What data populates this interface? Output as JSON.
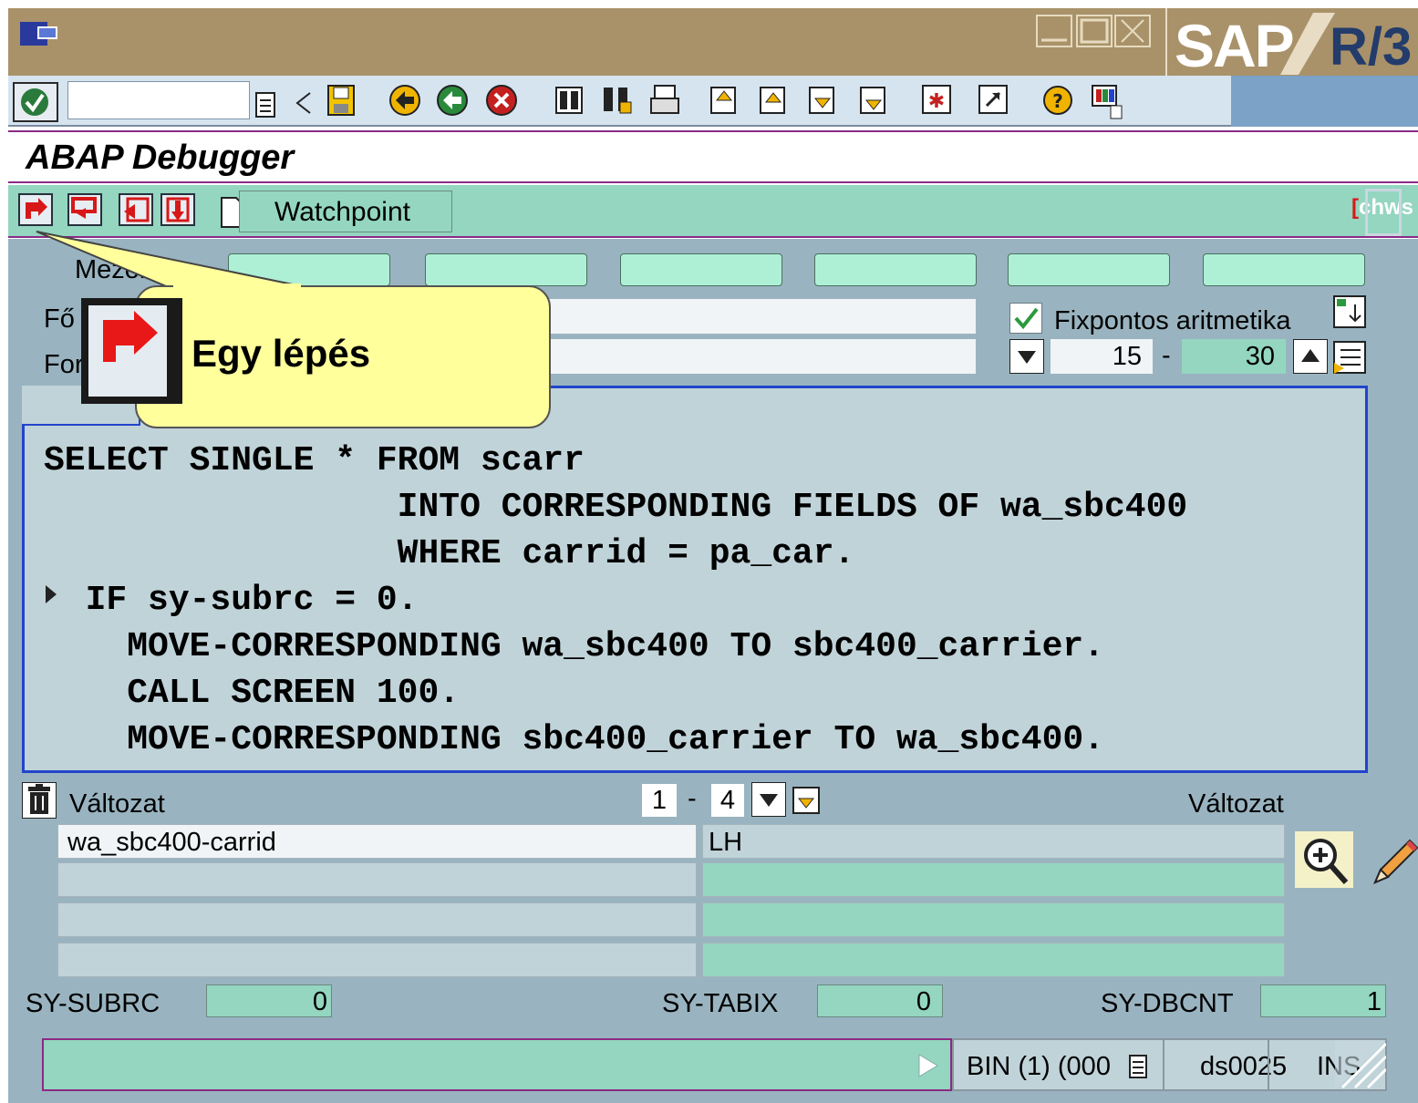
{
  "window": {
    "brand": "SAP",
    "brand_suffix": "R/3"
  },
  "screen": {
    "title": "ABAP Debugger"
  },
  "app_toolbar": {
    "watchpoint_label": "Watchpoint",
    "right_label": "chws"
  },
  "fields": {
    "tab_label": "Mezok",
    "main_prog_label": "Fő",
    "source_label": "For",
    "fixpoint_label": "Fixpontos aritmetika",
    "line_from": "15",
    "range_sep": "-",
    "line_to": "30"
  },
  "code_lines": [
    "SELECT SINGLE * FROM scarr",
    "                 INTO CORRESPONDING FIELDS OF wa_sbc400",
    "                 WHERE carrid = pa_car.",
    "  IF sy-subrc = 0.",
    "    MOVE-CORRESPONDING wa_sbc400 TO sbc400_carrier.",
    "    CALL SCREEN 100.",
    "    MOVE-CORRESPONDING sbc400_carrier TO wa_sbc400."
  ],
  "variables": {
    "header_left": "Változat",
    "header_right": "Változat",
    "page_from": "1",
    "page_sep": "-",
    "page_to": "4",
    "rows": [
      {
        "name": "wa_sbc400-carrid",
        "value": "LH"
      },
      {
        "name": "",
        "value": ""
      },
      {
        "name": "",
        "value": ""
      },
      {
        "name": "",
        "value": ""
      }
    ]
  },
  "system_fields": {
    "subrc_label": "SY-SUBRC",
    "subrc_value": "0",
    "tabix_label": "SY-TABIX",
    "tabix_value": "0",
    "dbcnt_label": "SY-DBCNT",
    "dbcnt_value": "1"
  },
  "status": {
    "system": "BIN (1) (000",
    "server": "ds0025",
    "mode": "INS"
  },
  "tooltip": {
    "text": "Egy lépés"
  },
  "colors": {
    "titlebar": "#a99269",
    "panel": "#99b4c0",
    "teal": "#94d6c0",
    "code_border": "#2244cc",
    "tooltip": "#ffff9c"
  }
}
